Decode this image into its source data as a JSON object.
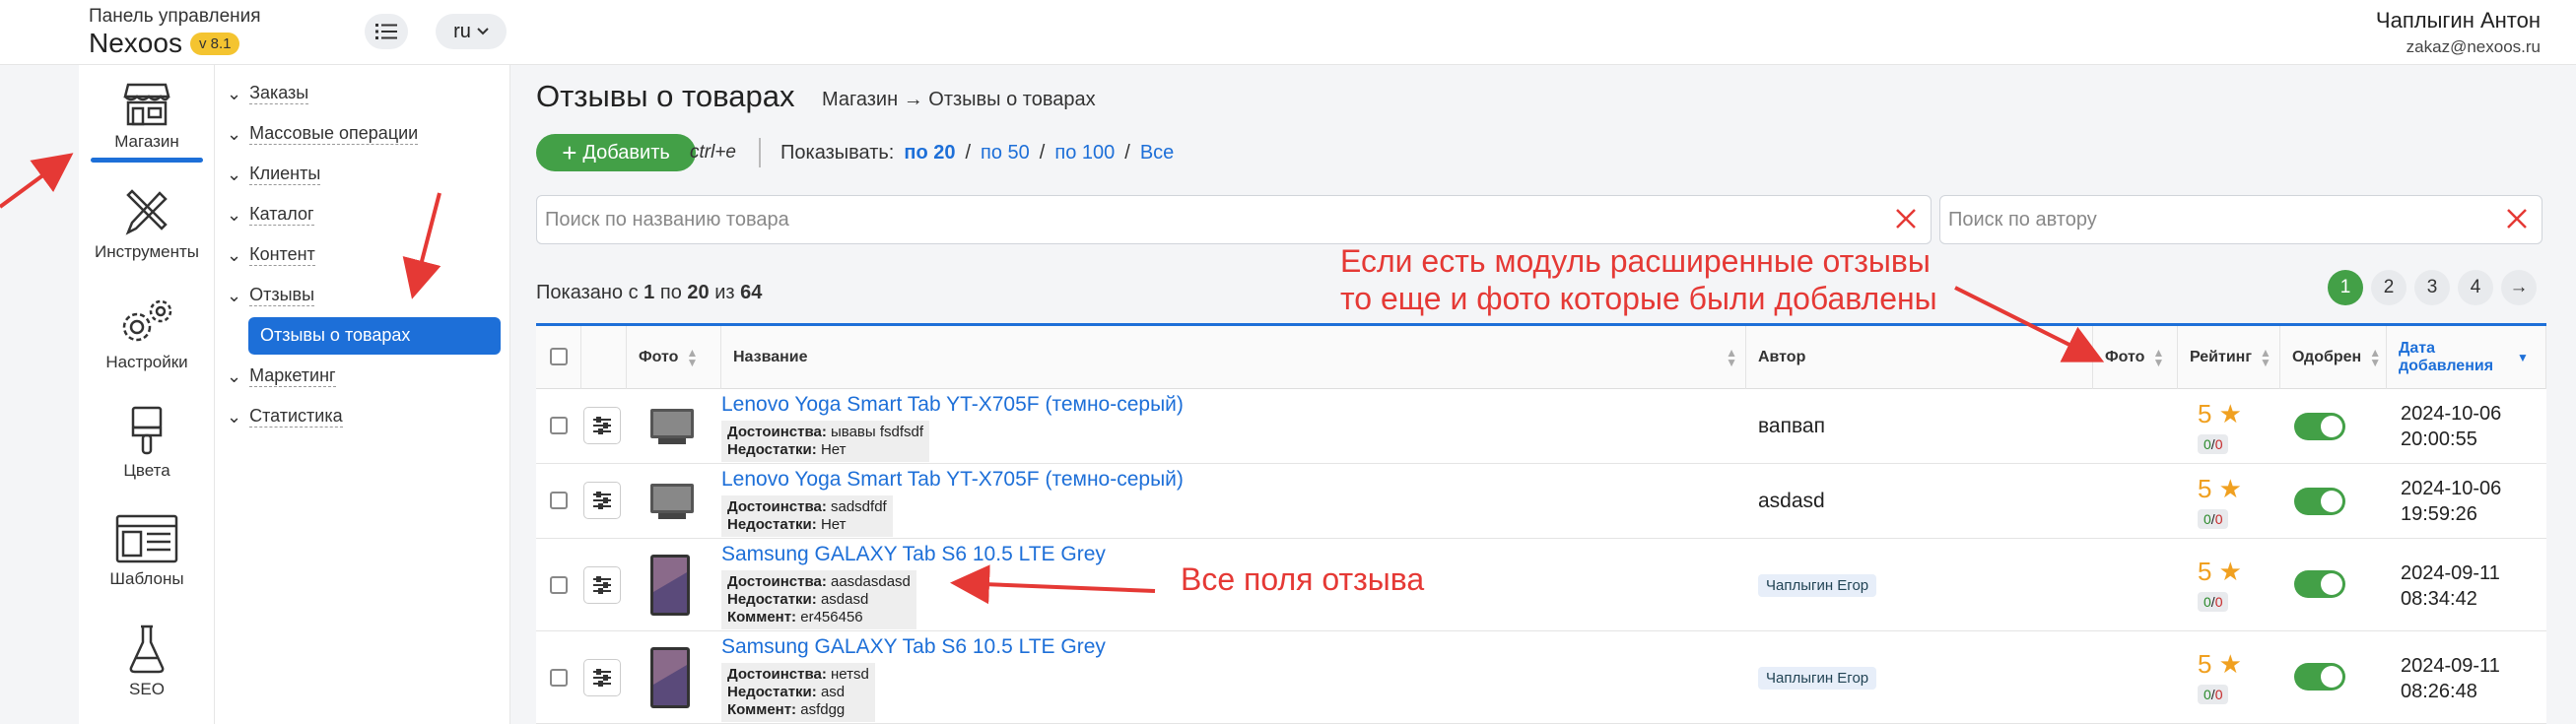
{
  "header": {
    "panel_label": "Панель управления",
    "brand": "Nexoos",
    "version": "v 8.1",
    "lang": "ru",
    "user_name": "Чаплыгин Антон",
    "user_email": "zakaz@nexoos.ru"
  },
  "iconbar": {
    "items": [
      {
        "label": "Магазин",
        "icon": "shop-icon"
      },
      {
        "label": "Инструменты",
        "icon": "tools-icon"
      },
      {
        "label": "Настройки",
        "icon": "gear-icon"
      },
      {
        "label": "Цвета",
        "icon": "brush-icon"
      },
      {
        "label": "Шаблоны",
        "icon": "template-icon"
      },
      {
        "label": "SEO",
        "icon": "flask-icon"
      }
    ]
  },
  "submenu": {
    "items": [
      "Заказы",
      "Массовые операции",
      "Клиенты",
      "Каталог",
      "Контент",
      "Отзывы",
      "Маркетинг",
      "Статистика"
    ],
    "selected": "Отзывы о товарах"
  },
  "main": {
    "title": "Отзывы о товарах",
    "breadcrumb": "Магазин → Отзывы о товарах",
    "add_label": "Добавить",
    "shortcut": "ctrl+e",
    "show_label": "Показывать:",
    "show_options": [
      "по 20",
      "по 50",
      "по 100",
      "Все"
    ],
    "search_product_placeholder": "Поиск по названию товара",
    "search_author_placeholder": "Поиск по автору",
    "shown_prefix": "Показано с",
    "shown_from": "1",
    "shown_mid": "по",
    "shown_to": "20",
    "shown_of": "из",
    "shown_total": "64",
    "pages": [
      "1",
      "2",
      "3",
      "4"
    ]
  },
  "table": {
    "headers": {
      "photo": "Фото",
      "name": "Название",
      "author": "Автор",
      "photo2": "Фото",
      "rating": "Рейтинг",
      "approved": "Одобрен",
      "date": "Дата добавления"
    },
    "labels": {
      "pros": "Достоинства:",
      "cons": "Недостатки:",
      "comment": "Коммент:"
    },
    "rows": [
      {
        "name": "Lenovo Yoga Smart Tab YT-X705F (темно-серый)",
        "pros": "ывавы fsdfsdf",
        "cons": "Нет",
        "comment": "",
        "author": "вапвап",
        "rating": "5 ★",
        "up": "0",
        "down": "0",
        "date": "2024-10-06",
        "time": "20:00:55"
      },
      {
        "name": "Lenovo Yoga Smart Tab YT-X705F (темно-серый)",
        "pros": "sadsdfdf",
        "cons": "Нет",
        "comment": "",
        "author": "asdasd",
        "rating": "5 ★",
        "up": "0",
        "down": "0",
        "date": "2024-10-06",
        "time": "19:59:26"
      },
      {
        "name": "Samsung GALAXY Tab S6 10.5 LTE Grey",
        "pros": "aasdasdasd",
        "cons": "asdasd",
        "comment": "er456456",
        "author": "Чаплыгин Егор",
        "rating": "5 ★",
        "up": "0",
        "down": "0",
        "date": "2024-09-11",
        "time": "08:34:42"
      },
      {
        "name": "Samsung GALAXY Tab S6 10.5 LTE Grey",
        "pros": "нетsd",
        "cons": "asd",
        "comment": "asfdgg",
        "author": "Чаплыгин Егор",
        "rating": "5 ★",
        "up": "0",
        "down": "0",
        "date": "2024-09-11",
        "time": "08:26:48"
      }
    ]
  },
  "annotations": {
    "photo_note_line1": "Если есть модуль расширенные отзывы",
    "photo_note_line2": "то еще и фото которые были добавлены",
    "fields_note": "Все поля отзыва"
  },
  "colors": {
    "accent": "#1d6fd8",
    "green": "#43a047",
    "annotation": "#e53935"
  }
}
